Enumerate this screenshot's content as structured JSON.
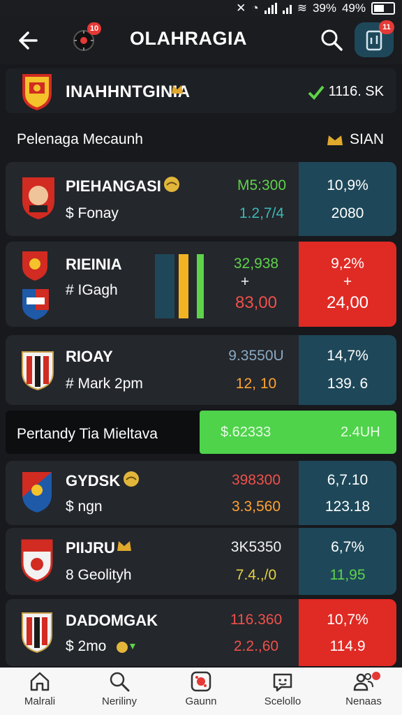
{
  "status": {
    "battery": "49%",
    "signal_text": "39%"
  },
  "colors": {
    "teal": "#1e4859",
    "red": "#e02a24",
    "green": "#4ed34a",
    "card": "#24272c"
  },
  "header": {
    "title": "OLAHRAGIA",
    "logo_badge": "10",
    "grid_badge": "11"
  },
  "league": {
    "name": "INAHHNTGINIA",
    "right_label": "1116. SK"
  },
  "section": {
    "title": "Pelenaga Mecaunh",
    "right_label": "SIAN"
  },
  "matches": [
    {
      "name": "PIEHANGASI",
      "sub": "$ Fonay",
      "odd_top": "M5:300",
      "odd_bottom": "1.2,7/4",
      "pct_top": "10,9%",
      "pct_bottom": "2080",
      "highlight": "teal"
    },
    {
      "name": "RIEINIA",
      "sub": "# IGagh",
      "odd_top": "32,938",
      "odd_mid": "+",
      "odd_bottom": "83,00",
      "pct_top": "9,2%",
      "pct_mid": "+",
      "pct_bottom": "24,00",
      "highlight": "red"
    },
    {
      "name": "RIOAY",
      "sub": "# Mark 2pm",
      "odd_top": "9.3550U",
      "odd_bottom": "12, 10",
      "pct_top": "14,7%",
      "pct_bottom": "139. 6",
      "highlight": "teal"
    },
    {
      "name": "GYDSK",
      "sub": "$ ngn",
      "odd_top": "398300",
      "odd_bottom": "3.3,560",
      "pct_top": "6,7.10",
      "pct_bottom": "123.18",
      "highlight": "teal"
    },
    {
      "name": "PIIJRU",
      "sub": "8 Geolityh",
      "odd_top": "3K5350",
      "odd_bottom": "7.4.,/0",
      "pct_top": "6,7%",
      "pct_bottom": "11,95",
      "highlight": "teal"
    },
    {
      "name": "DADOMGAK",
      "sub": "$ 2mo",
      "odd_top": "116.360",
      "odd_bottom": "2.2.,60",
      "pct_top": "10,7%",
      "pct_bottom": "114.9",
      "highlight": "red"
    }
  ],
  "promo": {
    "text": "Pertandy Tia Mieltava",
    "value": "$.62333",
    "value2": "2.4UH"
  },
  "nav": [
    {
      "label": "Malrali",
      "icon": "home-icon"
    },
    {
      "label": "Neriliny",
      "icon": "search-icon"
    },
    {
      "label": "Gaunn",
      "icon": "game-icon"
    },
    {
      "label": "Scelollo",
      "icon": "chat-face-icon"
    },
    {
      "label": "Nenaas",
      "icon": "people-icon"
    }
  ]
}
